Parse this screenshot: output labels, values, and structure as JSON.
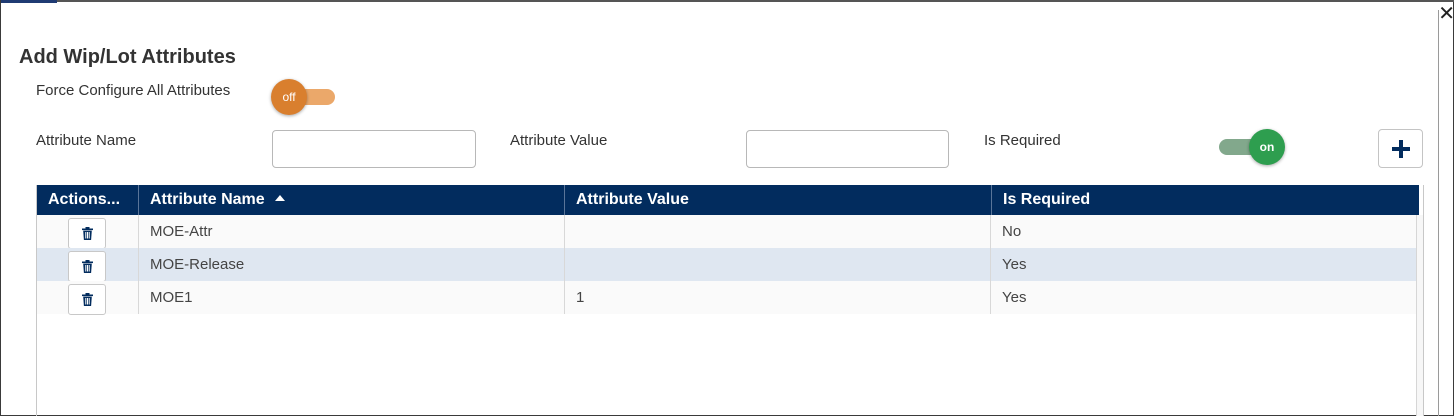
{
  "dialog": {
    "title": "Add Wip/Lot Attributes",
    "close_icon": "close-icon"
  },
  "form": {
    "force_configure_label": "Force Configure All Attributes",
    "force_configure_toggle": {
      "state_label": "off",
      "value": false,
      "color": "#d97f2e"
    },
    "attribute_name_label": "Attribute Name",
    "attribute_name_value": "",
    "attribute_value_label": "Attribute Value",
    "attribute_value_value": "",
    "is_required_label": "Is Required",
    "is_required_toggle": {
      "state_label": "on",
      "value": true,
      "color": "#2e9e4f"
    },
    "add_button_icon": "plus-icon"
  },
  "grid": {
    "header_color": "#022c5e",
    "columns": [
      "Actions...",
      "Attribute Name",
      "Attribute Value",
      "Is Required"
    ],
    "sort": {
      "column": "Attribute Name",
      "direction": "ascending"
    },
    "rows": [
      {
        "name": "MOE-Attr",
        "value": "",
        "required": "No"
      },
      {
        "name": "MOE-Release",
        "value": "",
        "required": "Yes"
      },
      {
        "name": "MOE1",
        "value": "1",
        "required": "Yes"
      }
    ],
    "row_action_icon": "trash-icon"
  }
}
